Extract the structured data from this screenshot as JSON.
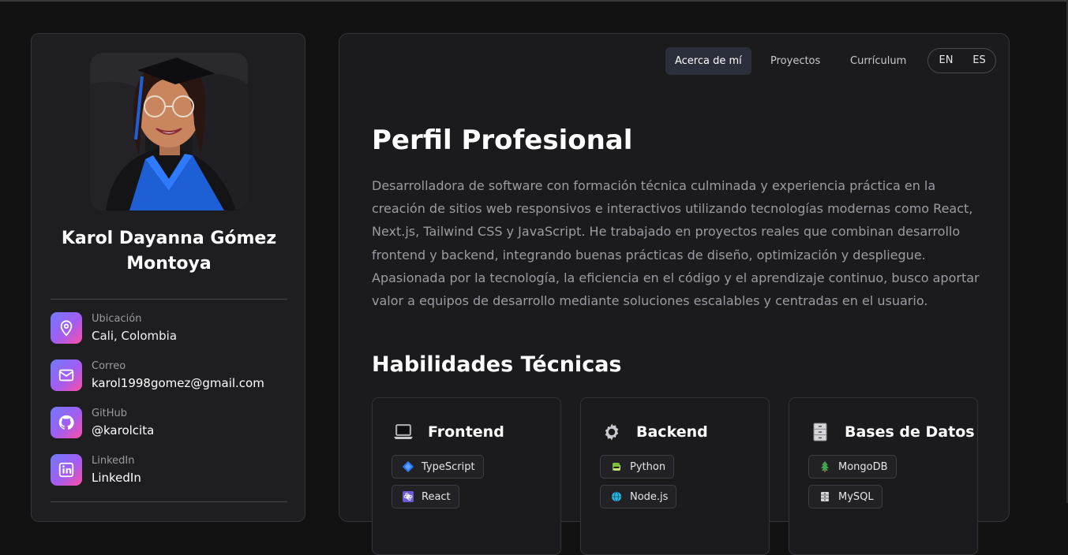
{
  "sidebar": {
    "name": "Karol Dayanna Gómez Montoya",
    "contacts": [
      {
        "label": "Ubicación",
        "value": "Cali, Colombia",
        "icon": "location-pin-icon"
      },
      {
        "label": "Correo",
        "value": "karol1998gomez@gmail.com",
        "icon": "mail-icon"
      },
      {
        "label": "GitHub",
        "value": "@karolcita",
        "icon": "github-icon"
      },
      {
        "label": "LinkedIn",
        "value": "LinkedIn",
        "icon": "linkedin-icon"
      }
    ]
  },
  "nav": {
    "items": [
      "Acerca de mí",
      "Proyectos",
      "Currículum"
    ],
    "active": "Acerca de mí",
    "languages": [
      "EN",
      "ES"
    ]
  },
  "main": {
    "profile_title": "Perfil Profesional",
    "profile_summary": "Desarrolladora de software con formación técnica culminada y experiencia práctica en la creación de sitios web responsivos e interactivos utilizando tecnologías modernas como React, Next.js, Tailwind CSS y JavaScript. He trabajado en proyectos reales que combinan desarrollo frontend y backend, integrando buenas prácticas de diseño, optimización y despliegue. Apasionada por la tecnología, la eficiencia en el código y el aprendizaje continuo, busco aportar valor a equipos de desarrollo mediante soluciones escalables y centradas en el usuario.",
    "skills_title": "Habilidades Técnicas",
    "skill_groups": [
      {
        "title": "Frontend",
        "icon": "laptop-icon",
        "items": [
          "TypeScript",
          "React"
        ]
      },
      {
        "title": "Backend",
        "icon": "gear-icon",
        "items": [
          "Python",
          "Node.js"
        ]
      },
      {
        "title": "Bases de Datos",
        "icon": "filing-cabinet-icon",
        "items": [
          "MongoDB",
          "MySQL"
        ]
      }
    ]
  },
  "colors": {
    "background": "#121212",
    "card": "#1e1e20",
    "accent_gradient_start": "#6f7bff",
    "accent_gradient_end": "#ff4fa3",
    "active_nav": "#2a2f3b"
  }
}
